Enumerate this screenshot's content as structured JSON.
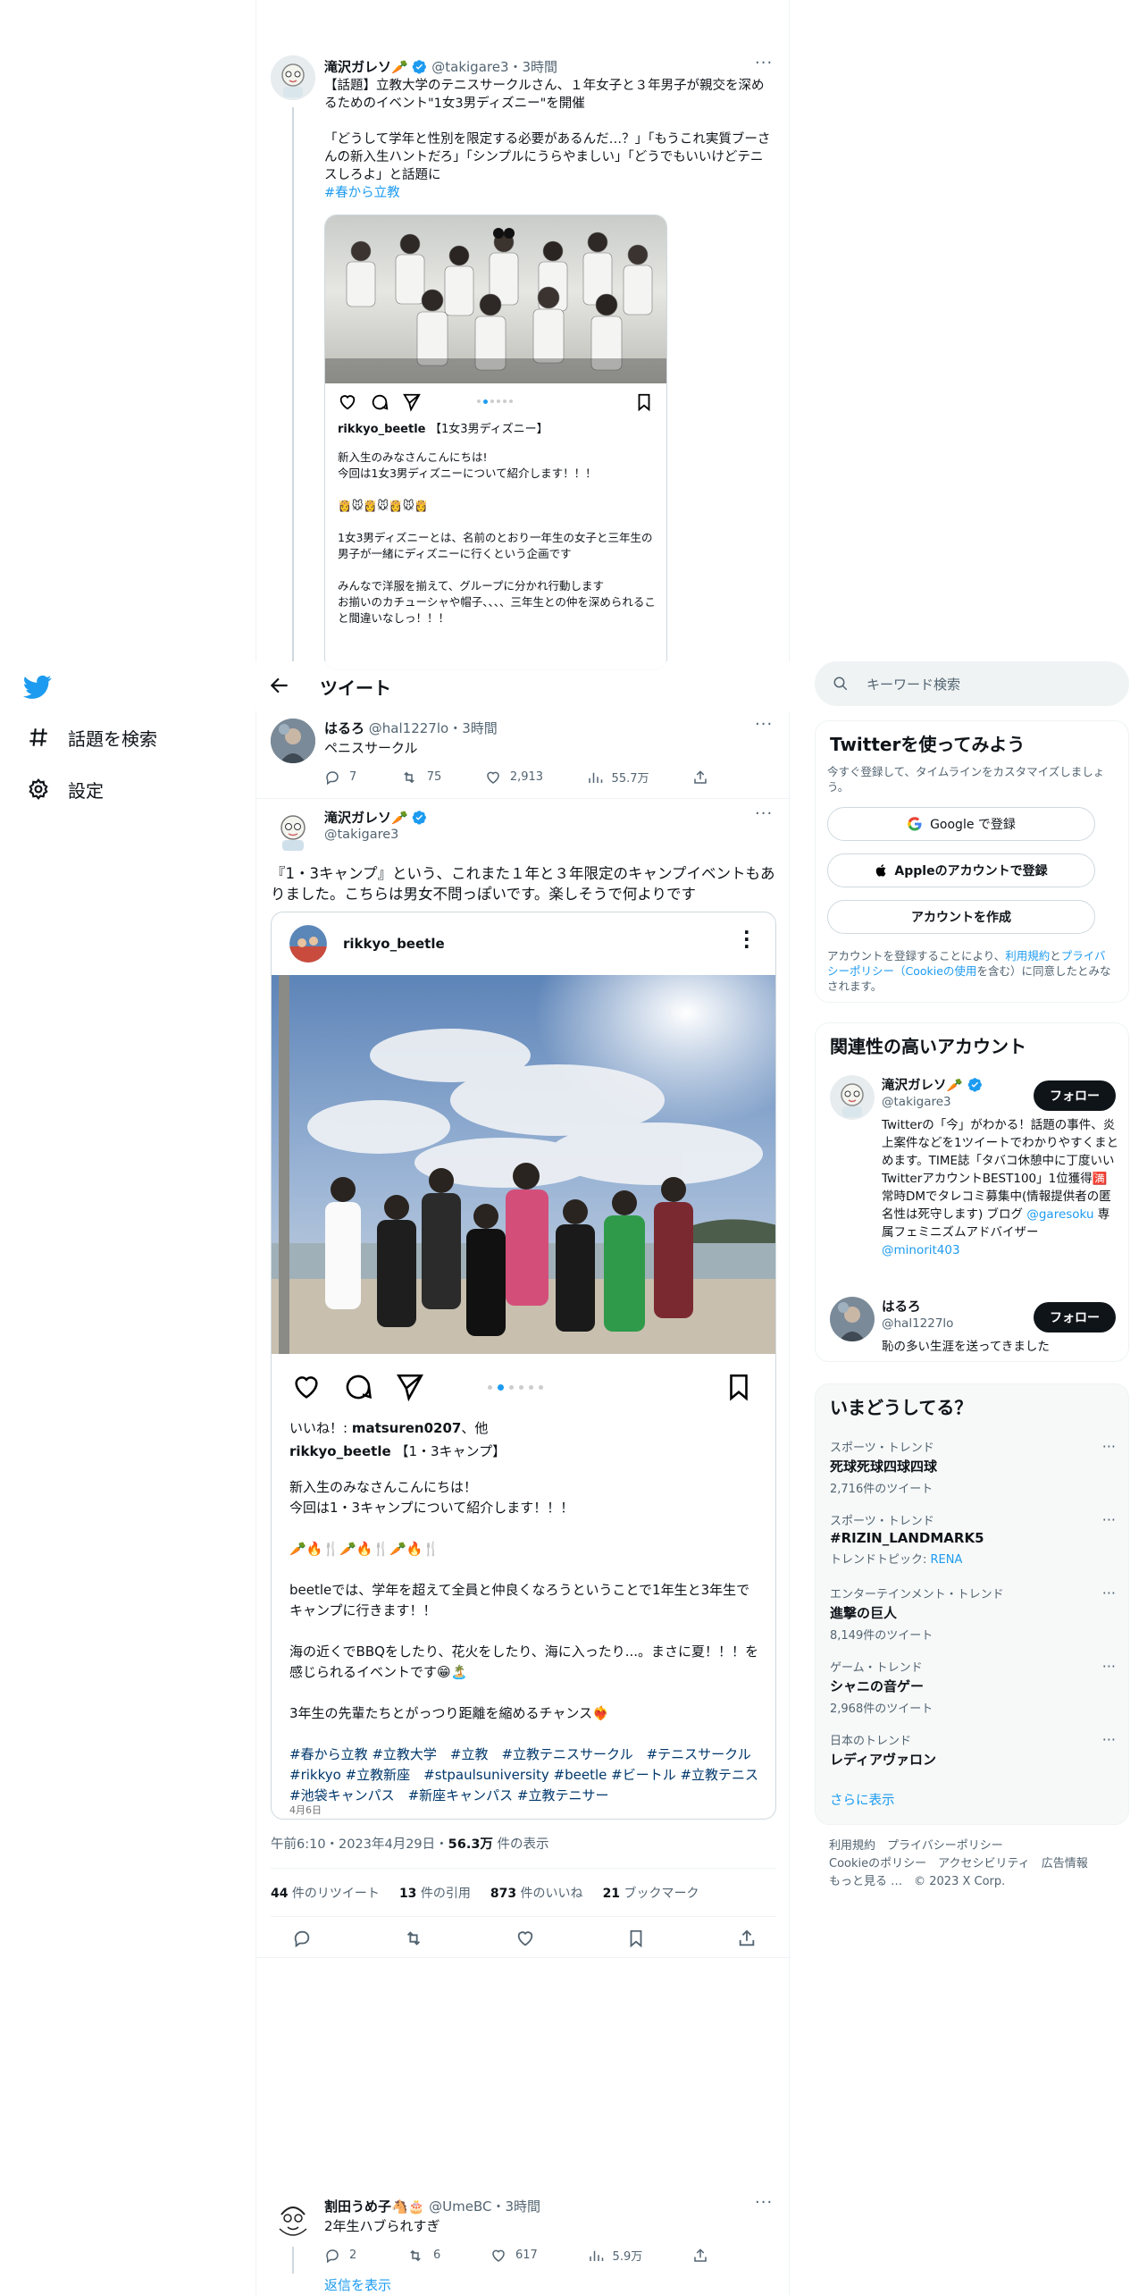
{
  "nav": {
    "explore_label": "話題を検索",
    "settings_label": "設定"
  },
  "header": {
    "back_icon": "arrow-left-icon",
    "title": "ツイート"
  },
  "prev_tweet": {
    "name": "滝沢ガレソ🥕",
    "handle": "@takigare3",
    "time": "3時間",
    "text1": "【話題】立教大学のテニスサークルさん、１年女子と３年男子が親交を深めるためのイベント\"1女3男ディズニー\"を開催",
    "text2": "「どうして学年と性別を限定する必要があるんだ…？」「もうこれ実質ブーさんの新入生ハントだろ」「シンプルにうらやましい」「どうでもいいけどテニスしろよ」と話題に",
    "hashtag": "#春から立教",
    "ig_user": "rikkyo_beetle",
    "ig_title": "【1女3男ディズニー】",
    "ig_line1": "新入生のみなさんこんにちは!",
    "ig_line2": "今回は1女3男ディズニーについて紹介します！！！",
    "ig_emojis": "👸🐭👸🐭👸🐭👸",
    "ig_line3": "1女3男ディズニーとは、名前のとおり一年生の女子と三年生の男子が一緒にディズニーに行くという企画です",
    "ig_line4": "みんなで洋服を揃えて、グループに分かれ行動します",
    "ig_line5": "お揃いのカチューシャや帽子、、、、三年生との仲を深められること間違いなしっ！！！"
  },
  "reply_tweet": {
    "name": "はるろ",
    "handle": "@hal1227lo",
    "time": "3時間",
    "text": "ペニスサークル",
    "replies": "7",
    "retweets": "75",
    "likes": "2,913",
    "views": "55.7万"
  },
  "main_tweet": {
    "name": "滝沢ガレソ🥕",
    "handle": "@takigare3",
    "text": "『1・3キャンプ』という、これまた１年と３年限定のキャンプイベントもありました。こちらは男女不問っぽいです。楽しそうで何よりです",
    "ig_user": "rikkyo_beetle",
    "ig_likes_prefix": "いいね！: ",
    "ig_likes_user": "matsuren0207",
    "ig_likes_suffix": "、他",
    "ig_caption_user": "rikkyo_beetle",
    "ig_caption_title": "【1・3キャンプ】",
    "ig_p1a": "新入生のみなさんこんにちは！",
    "ig_p1b": "今回は1・3キャンプについて紹介します！！！",
    "ig_emojis": "🥕🔥🍴🥕🔥🍴🥕🔥🍴",
    "ig_p2": "beetleでは、学年を超えて全員と仲良くなろうということで1年生と3年生でキャンプに行きます！！",
    "ig_p3": "海の近くでBBQをしたり、花火をしたり、海に入ったり...。まさに夏！！！を感じられるイベントです😁🏝️",
    "ig_p4": "3年生の先輩たちとがっつり距離を縮めるチャンス❤️‍🔥",
    "ig_tags": "#春から立教 #立教大学　#立教　#立教テニスサークル　#テニスサークル #rikkyo #立教新座　#stpaulsuniversity #beetle #ビートル #立教テニス　#池袋キャンパス　#新座キャンパス #立教テニサー",
    "ig_date": "4月6日",
    "meta_time": "午前6:10・2023年4月29日・",
    "meta_views": "56.3万",
    "meta_views_suffix": " 件の表示",
    "stats": [
      {
        "num": "44",
        "label": " 件のリツイート"
      },
      {
        "num": "13",
        "label": " 件の引用"
      },
      {
        "num": "873",
        "label": " 件のいいね"
      },
      {
        "num": "21",
        "label": " ブックマーク"
      }
    ]
  },
  "bottom_tweet": {
    "name": "割田うめ子🐴🎂",
    "handle": "@UmeBC",
    "time": "3時間",
    "text": "2年生ハブられすぎ",
    "replies": "2",
    "retweets": "6",
    "likes": "617",
    "views": "5.9万",
    "show_replies": "返信を表示"
  },
  "sidebar": {
    "search_placeholder": "キーワード検索",
    "signup": {
      "title": "Twitterを使ってみよう",
      "subtitle": "今すぐ登録して、タイムラインをカスタマイズしましょう。",
      "google": "Google で登録",
      "apple": "Appleのアカウントで登録",
      "create": "アカウントを作成",
      "legal_pre": "アカウントを登録することにより、",
      "legal_terms": "利用規約",
      "legal_and": "と",
      "legal_privacy": "プライバシーポリシー（Cookieの使用",
      "legal_post": "を含む）に同意したとみなされます。"
    },
    "related": {
      "title": "関連性の高いアカウント",
      "follow": "フォロー",
      "accounts": [
        {
          "name": "滝沢ガレソ🥕",
          "handle": "@takigare3",
          "bio": "Twitterの「今」がわかる！話題の事件、炎上案件などを1ツイートでわかりやすくまとめます。TIME誌「タバコ休憩中に丁度いいTwitterアカウントBEST100」1位獲得🈵常時DMでタレコミ募集中(情報提供者の匿名性は死守します) ブログ",
          "bio_link1": "@garesoku",
          "bio_mid": " 専属フェミニズムアドバイザー ",
          "bio_link2": "@minorit403"
        },
        {
          "name": "はるろ",
          "handle": "@hal1227lo",
          "bio": "恥の多い生涯を送ってきました"
        }
      ]
    },
    "trends": {
      "title": "いまどうしてる？",
      "items": [
        {
          "cat": "スポーツ・トレンド",
          "name": "死球死球四球四球",
          "count": "2,716件のツイート"
        },
        {
          "cat": "スポーツ・トレンド",
          "name": "#RIZIN_LANDMARK5",
          "count": "トレンドトピック: ",
          "topic": "RENA"
        },
        {
          "cat": "エンターテインメント・トレンド",
          "name": "進撃の巨人",
          "count": "8,149件のツイート"
        },
        {
          "cat": "ゲーム・トレンド",
          "name": "シャニの音ゲー",
          "count": "2,968件のツイート"
        },
        {
          "cat": "日本のトレンド",
          "name": "レディアヴァロン",
          "count": ""
        }
      ],
      "show_more": "さらに表示"
    },
    "footer": {
      "line1": "利用規約　プライバシーポリシー",
      "line2": "Cookieのポリシー　アクセシビリティ　広告情報",
      "line3": "もっと見る …　© 2023 X Corp."
    }
  }
}
